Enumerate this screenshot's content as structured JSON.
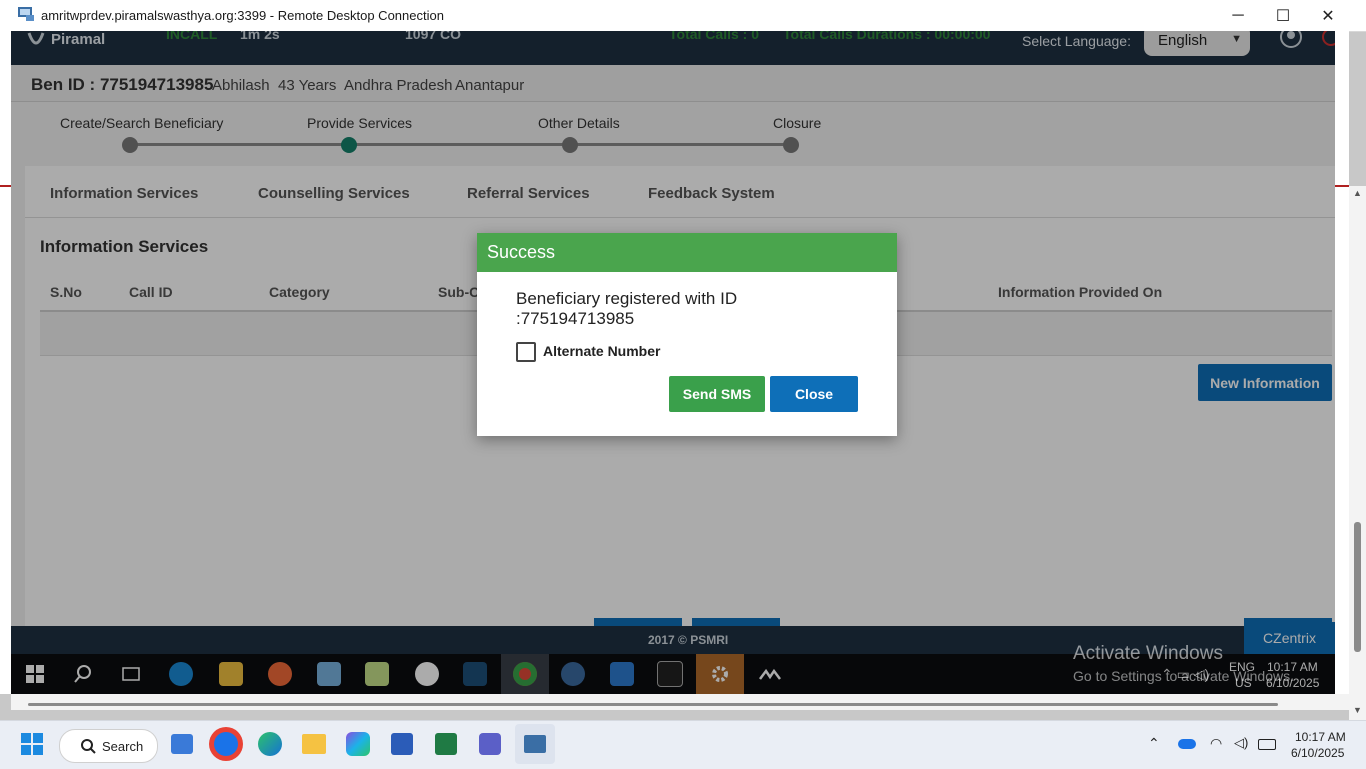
{
  "rdp": {
    "title": "amritwprdev.piramalswasthya.org:3399 - Remote Desktop Connection",
    "controls": {
      "minimize": "─",
      "maximize": "☐",
      "close": "✕"
    }
  },
  "header": {
    "logo": "Piramal",
    "status": "INCALL",
    "timer": "1m 2s",
    "helpline": "1097 CO",
    "total_calls": "Total Calls : 0",
    "total_duration": "Total Calls Durations : 00:00:00",
    "language_label": "Select Language:",
    "language_value": "English"
  },
  "beneficiary": {
    "id_label": "Ben ID : 775194713985",
    "name": "Abhilash",
    "age": "43 Years",
    "state": "Andhra Pradesh",
    "district": "Anantapur"
  },
  "stepper": [
    {
      "label": "Create/Search Beneficiary"
    },
    {
      "label": "Provide Services"
    },
    {
      "label": "Other Details"
    },
    {
      "label": "Closure"
    }
  ],
  "tabs": [
    {
      "label": "Information Services"
    },
    {
      "label": "Counselling Services"
    },
    {
      "label": "Referral Services"
    },
    {
      "label": "Feedback System"
    }
  ],
  "section": {
    "title": "Information Services",
    "columns": [
      "S.No",
      "Call ID",
      "Category",
      "Sub-C",
      "Information Provided On"
    ],
    "new_button": "New Information"
  },
  "footer": {
    "copyright": "2017 © PSMRI",
    "brand": "CZentrix"
  },
  "modal": {
    "title": "Success",
    "message": "Beneficiary registered with ID :775194713985",
    "checkbox_label": "Alternate Number",
    "send_sms": "Send SMS",
    "close": "Close"
  },
  "watermark": {
    "line1": "Activate Windows",
    "line2": "Go to Settings to activate Windows."
  },
  "remote_tray": {
    "lang1": "ENG",
    "lang2": "US",
    "time": "10:17 AM",
    "date": "6/10/2025"
  },
  "host_taskbar": {
    "search": "Search",
    "time": "10:17 AM",
    "date": "6/10/2025"
  },
  "colors": {
    "header": "#1f3142",
    "success": "#4aa54d",
    "primary": "#0e6fb8",
    "accent_green": "#3aa04b"
  }
}
